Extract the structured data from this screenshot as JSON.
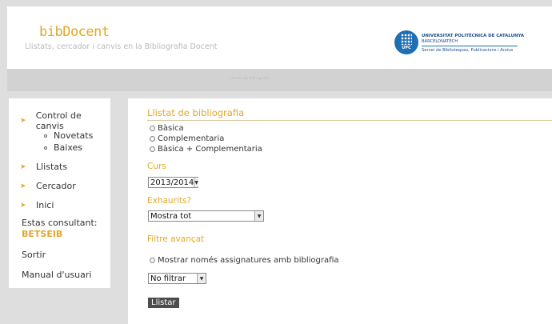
{
  "header": {
    "title": "bibDocent",
    "subtitle": "Llistats, cercador i canvis en la Bibliografia Docent",
    "logo": {
      "line1": "UNIVERSITAT POLITÈCNICA DE CATALUNYA",
      "line2": "BARCELONATECH",
      "line3": "Servei de Biblioteques, Publicacions i Arxius",
      "mark": "UPC"
    }
  },
  "strip": {
    "text": "Llistats de bibliografia"
  },
  "sidebar": {
    "control_canvis": "Control de canvis",
    "novetats": "Novetats",
    "baixes": "Baixes",
    "llistats": "Llistats",
    "cercador": "Cercador",
    "inici": "Inici",
    "consultant_label": "Estas consultant:",
    "consultant_value": "BETSEIB",
    "sortir": "Sortir",
    "manual": "Manual d'usuari",
    "arrow_icon": "arrow-right-icon"
  },
  "main": {
    "title": "Llistat de bibliografia",
    "options": [
      "Bàsica",
      "Complementaria",
      "Bàsica + Complementaria"
    ],
    "curs_label": "Curs",
    "curs_value": "2013/2014",
    "exhaurits_label": "Exhaurits?",
    "exhaurits_value": "Mostra tot",
    "filtre_label": "Filtre avançat",
    "mostrar_option": "Mostrar només assignatures amb bibliografia",
    "filtrar_value": "No filtrar",
    "submit": "Llistar"
  },
  "colors": {
    "accent": "#e0a82a",
    "brand_blue": "#1f6fb3",
    "background": "#dedede"
  }
}
